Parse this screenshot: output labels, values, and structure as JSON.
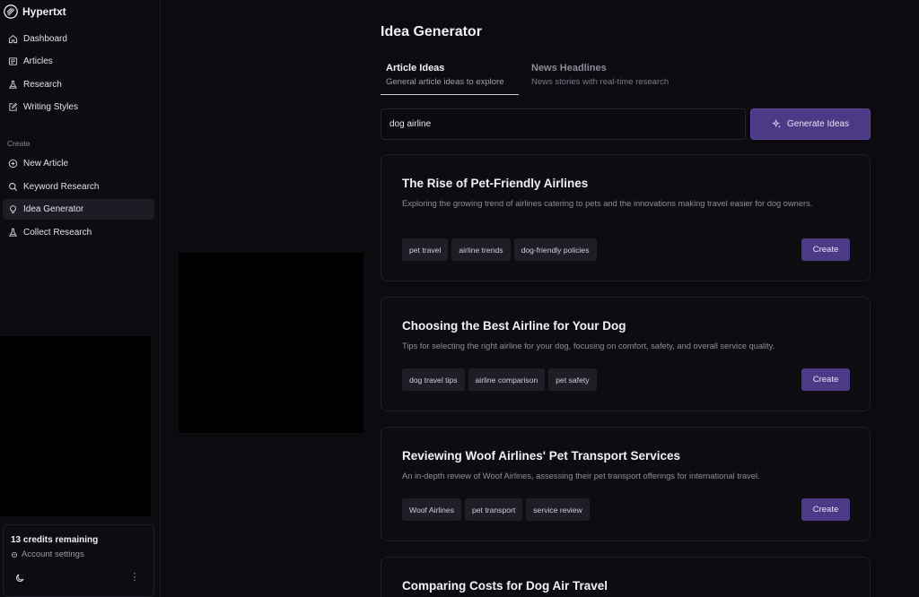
{
  "app": {
    "name": "Hypertxt"
  },
  "sidebar": {
    "nav": [
      {
        "label": "Dashboard",
        "icon": "home-icon"
      },
      {
        "label": "Articles",
        "icon": "newspaper-icon"
      },
      {
        "label": "Research",
        "icon": "flask-icon"
      },
      {
        "label": "Writing Styles",
        "icon": "pen-square-icon"
      }
    ],
    "create_label": "Create",
    "create_items": [
      {
        "label": "New Article",
        "icon": "plus-circle-icon"
      },
      {
        "label": "Keyword Research",
        "icon": "search-icon"
      },
      {
        "label": "Idea Generator",
        "icon": "lightbulb-icon",
        "active": true
      },
      {
        "label": "Collect Research",
        "icon": "flask-icon"
      }
    ],
    "footer": {
      "credits": "13 credits remaining",
      "account": "Account settings"
    }
  },
  "main": {
    "title": "Idea Generator",
    "tabs": [
      {
        "title": "Article Ideas",
        "subtitle": "General article ideas to explore",
        "active": true
      },
      {
        "title": "News Headlines",
        "subtitle": "News stories with real-time research",
        "active": false
      }
    ],
    "search": {
      "value": "dog airline"
    },
    "generate_label": "Generate Ideas",
    "ideas": [
      {
        "title": "The Rise of Pet-Friendly Airlines",
        "description": "Exploring the growing trend of airlines catering to pets and the innovations making travel easier for dog owners.",
        "tags": [
          "pet travel",
          "airline trends",
          "dog-friendly policies"
        ],
        "create_label": "Create"
      },
      {
        "title": "Choosing the Best Airline for Your Dog",
        "description": "Tips for selecting the right airline for your dog, focusing on comfort, safety, and overall service quality.",
        "tags": [
          "dog travel tips",
          "airline comparison",
          "pet safety"
        ],
        "create_label": "Create"
      },
      {
        "title": "Reviewing Woof Airlines' Pet Transport Services",
        "description": "An in-depth review of Woof Airlines, assessing their pet transport offerings for international travel.",
        "tags": [
          "Woof Airlines",
          "pet transport",
          "service review"
        ],
        "create_label": "Create"
      },
      {
        "title": "Comparing Costs for Dog Air Travel"
      }
    ]
  },
  "colors": {
    "background": "#0b0b10",
    "accent": "#4d3a86",
    "tag_bg": "#1e1e26"
  }
}
